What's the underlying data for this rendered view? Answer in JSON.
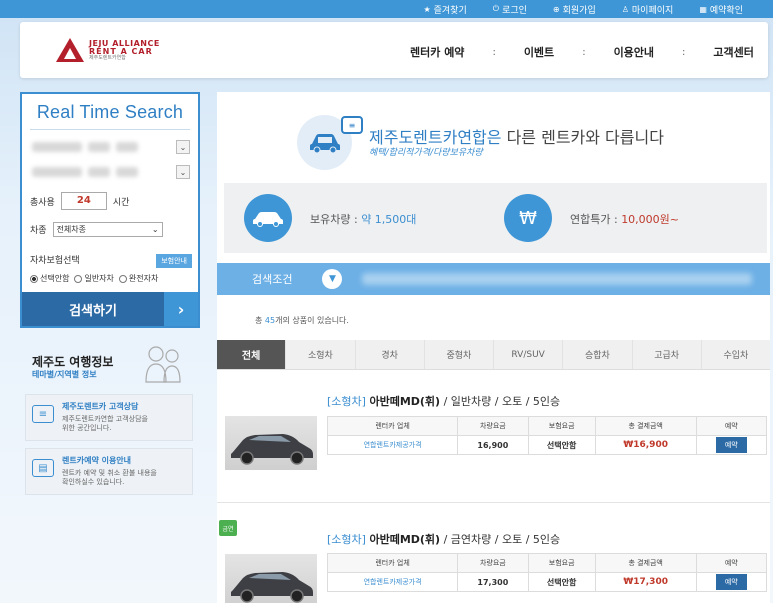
{
  "topbar": {
    "items": [
      {
        "icon": "star-icon",
        "label": "즐겨찾기"
      },
      {
        "icon": "power-icon",
        "label": "로그인"
      },
      {
        "icon": "user-add-icon",
        "label": "회원가입"
      },
      {
        "icon": "user-icon",
        "label": "마이페이지"
      },
      {
        "icon": "calendar-icon",
        "label": "예약확인"
      }
    ]
  },
  "header": {
    "logo": {
      "line1": "JEJU ALLIANCE",
      "line2": "RENT A CAR",
      "line3": "제주도렌트카연합"
    },
    "nav": [
      "렌터카 예약",
      "이벤트",
      "이용안내",
      "고객센터"
    ]
  },
  "search": {
    "title": "Real Time Search",
    "hours_label": "총사용",
    "hours_value": "24",
    "hours_unit": "시간",
    "car_type_label": "차종",
    "car_type_value": "전체차종",
    "insurance_label": "자차보험선택",
    "insurance_badge": "보험안내",
    "insurance_options": [
      "선택안함",
      "일반자차",
      "완전자차"
    ],
    "button": "검색하기"
  },
  "info": {
    "title": "제주도 여행정보",
    "subtitle": "테마별/지역별 정보",
    "cards": [
      {
        "title": "제주도렌트카 고객상담",
        "desc1": "제주도렌트카연합 고객상담을",
        "desc2": "위한 공간입니다."
      },
      {
        "title": "렌트카예약 이용안내",
        "desc1": "렌트카 예약 및 취소 환불 내용을",
        "desc2": "확인하실수 있습니다."
      }
    ]
  },
  "hero": {
    "title_highlight": "제주도렌트카연합은",
    "title_rest": " 다른 렌트카와 다릅니다",
    "subtitle": "혜택/합리적가격/다량보유차량"
  },
  "stats": {
    "fleet_label": "보유차량 : ",
    "fleet_value": "약 1,500대",
    "price_label": "연합특가 : ",
    "price_value": "10,000원~",
    "price_symbol": "₩"
  },
  "conditions": {
    "label": "검색조건"
  },
  "results": {
    "prefix": "총 ",
    "count": "45",
    "suffix": "개의 상품이 있습니다."
  },
  "tabs": [
    "전체",
    "소형차",
    "경차",
    "중형차",
    "RV/SUV",
    "승합차",
    "고급차",
    "수입차"
  ],
  "products": [
    {
      "category": "[소형차]",
      "name": "아반떼MD(휘)",
      "specs": " / 일반차량 / 오토 / 5인승",
      "headers": [
        "렌터카 업체",
        "차량요금",
        "보험요금",
        "총 결제금액",
        "예약"
      ],
      "firm": "연합렌트카제공가격",
      "car_fee": "16,900",
      "insurance": "선택안함",
      "total": "₩16,900",
      "reserve": "예약",
      "badge": ""
    },
    {
      "category": "[소형차]",
      "name": "아반떼MD(휘)",
      "specs": " / 금연차량 / 오토 / 5인승",
      "headers": [
        "렌터카 업체",
        "차량요금",
        "보험요금",
        "총 결제금액",
        "예약"
      ],
      "firm": "연합렌트카제공가격",
      "car_fee": "17,300",
      "insurance": "선택안함",
      "total": "₩17,300",
      "reserve": "예약",
      "badge": "금연"
    }
  ]
}
